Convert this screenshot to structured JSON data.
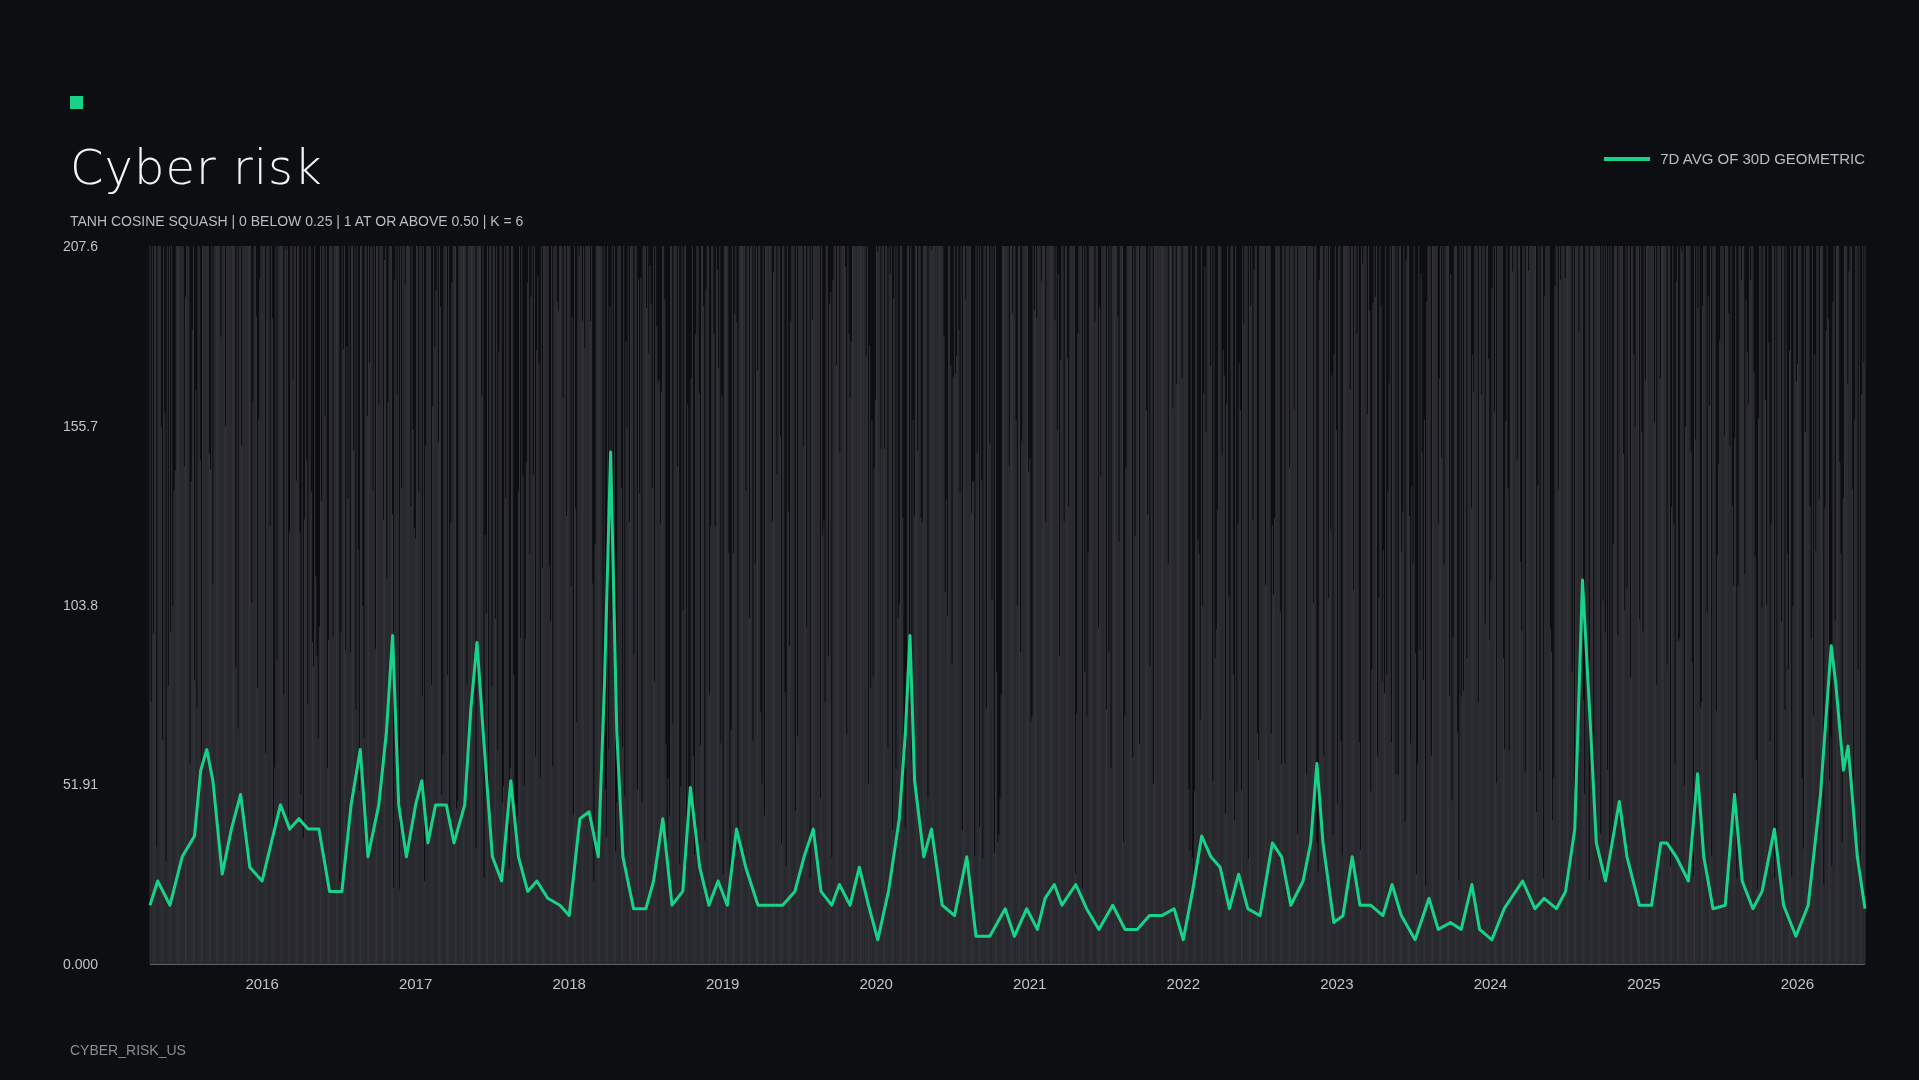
{
  "title": "Cyber risk",
  "subtitle": "TANH COSINE SQUASH | 0 BELOW 0.25 | 1 AT OR ABOVE 0.50 | K = 6",
  "chart_data": {
    "type": "line",
    "x": [
      2015.27,
      2015.32,
      2015.4,
      2015.48,
      2015.56,
      2015.6,
      2015.64,
      2015.68,
      2015.74,
      2015.8,
      2015.86,
      2015.92,
      2016.0,
      2016.06,
      2016.12,
      2016.18,
      2016.24,
      2016.3,
      2016.37,
      2016.44,
      2016.52,
      2016.58,
      2016.64,
      2016.69,
      2016.76,
      2016.81,
      2016.85,
      2016.89,
      2016.94,
      2017.0,
      2017.04,
      2017.08,
      2017.13,
      2017.2,
      2017.25,
      2017.32,
      2017.36,
      2017.4,
      2017.44,
      2017.5,
      2017.56,
      2017.62,
      2017.67,
      2017.73,
      2017.79,
      2017.86,
      2017.94,
      2018.0,
      2018.07,
      2018.13,
      2018.19,
      2018.23,
      2018.27,
      2018.31,
      2018.35,
      2018.42,
      2018.5,
      2018.55,
      2018.61,
      2018.67,
      2018.74,
      2018.79,
      2018.85,
      2018.91,
      2018.97,
      2019.03,
      2019.09,
      2019.15,
      2019.23,
      2019.31,
      2019.39,
      2019.47,
      2019.53,
      2019.59,
      2019.64,
      2019.71,
      2019.76,
      2019.83,
      2019.89,
      2019.95,
      2020.01,
      2020.08,
      2020.15,
      2020.19,
      2020.22,
      2020.25,
      2020.31,
      2020.36,
      2020.43,
      2020.51,
      2020.59,
      2020.65,
      2020.74,
      2020.84,
      2020.9,
      2020.98,
      2021.05,
      2021.1,
      2021.16,
      2021.21,
      2021.3,
      2021.37,
      2021.45,
      2021.54,
      2021.62,
      2021.7,
      2021.78,
      2021.86,
      2021.94,
      2022.0,
      2022.06,
      2022.12,
      2022.18,
      2022.24,
      2022.3,
      2022.36,
      2022.42,
      2022.5,
      2022.58,
      2022.64,
      2022.7,
      2022.78,
      2022.83,
      2022.87,
      2022.91,
      2022.98,
      2023.04,
      2023.1,
      2023.15,
      2023.22,
      2023.3,
      2023.36,
      2023.42,
      2023.51,
      2023.6,
      2023.66,
      2023.74,
      2023.81,
      2023.88,
      2023.93,
      2024.01,
      2024.09,
      2024.21,
      2024.29,
      2024.35,
      2024.43,
      2024.49,
      2024.55,
      2024.6,
      2024.65,
      2024.69,
      2024.75,
      2024.84,
      2024.89,
      2024.97,
      2025.05,
      2025.11,
      2025.15,
      2025.21,
      2025.29,
      2025.35,
      2025.39,
      2025.45,
      2025.53,
      2025.59,
      2025.64,
      2025.71,
      2025.77,
      2025.85,
      2025.91,
      2025.99,
      2026.07,
      2026.15,
      2026.22,
      2026.25,
      2026.3,
      2026.33,
      2026.39,
      2026.44
    ],
    "series": [
      {
        "name": "7D AVG OF 30D GEOMETRIC",
        "color": "#17d38a",
        "values": [
          17,
          24,
          17,
          31,
          37,
          56,
          62,
          53,
          26,
          39,
          49,
          28,
          24,
          35,
          46,
          39,
          42,
          39,
          39,
          21,
          21,
          46,
          62,
          31,
          46,
          67,
          95,
          46,
          31,
          46,
          53,
          35,
          46,
          46,
          35,
          46,
          74,
          93,
          67,
          31,
          24,
          53,
          31,
          21,
          24,
          19,
          17,
          14,
          42,
          44,
          31,
          81,
          148,
          67,
          31,
          16,
          16,
          24,
          42,
          17,
          21,
          51,
          28,
          17,
          24,
          17,
          39,
          28,
          17,
          17,
          17,
          21,
          31,
          39,
          21,
          17,
          23,
          17,
          28,
          17,
          7,
          21,
          42,
          67,
          95,
          53,
          31,
          39,
          17,
          14,
          31,
          8,
          8,
          16,
          8,
          16,
          10,
          19,
          23,
          17,
          23,
          16,
          10,
          17,
          10,
          10,
          14,
          14,
          16,
          7,
          21,
          37,
          31,
          28,
          16,
          26,
          16,
          14,
          35,
          31,
          17,
          24,
          35,
          58,
          35,
          12,
          14,
          31,
          17,
          17,
          14,
          23,
          14,
          7,
          19,
          10,
          12,
          10,
          23,
          10,
          7,
          16,
          24,
          16,
          19,
          16,
          21,
          39,
          111,
          70,
          35,
          24,
          47,
          31,
          17,
          17,
          35,
          35,
          31,
          24,
          55,
          31,
          16,
          17,
          49,
          24,
          16,
          21,
          39,
          17,
          8,
          17,
          49,
          92,
          81,
          56,
          63,
          31,
          16
        ]
      }
    ],
    "xlim": [
      2015.27,
      2026.44
    ],
    "ylim": [
      0,
      207.6
    ],
    "xticks": [
      2016,
      2017,
      2018,
      2019,
      2020,
      2021,
      2022,
      2023,
      2024,
      2025,
      2026
    ],
    "yticks": [
      {
        "value": 0,
        "label": "0.000"
      },
      {
        "value": 51.91,
        "label": "51.91"
      },
      {
        "value": 103.8,
        "label": "103.8"
      },
      {
        "value": 155.7,
        "label": "155.7"
      },
      {
        "value": 207.6,
        "label": "207.6"
      }
    ]
  },
  "footer": "CYBER_RISK_US"
}
